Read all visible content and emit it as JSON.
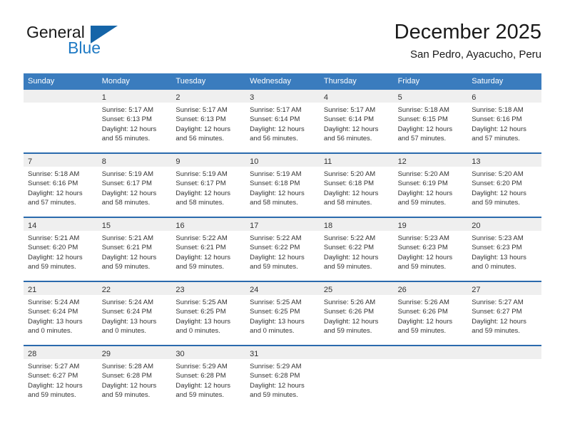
{
  "brand": {
    "name_part1": "General",
    "name_part2": "Blue",
    "accent_color": "#1565a8",
    "text_color": "#1f7ac4"
  },
  "header": {
    "title": "December 2025",
    "subtitle": "San Pedro, Ayacucho, Peru"
  },
  "theme": {
    "header_bg": "#3a7cbe",
    "week_divider": "#2a6aad",
    "day_number_bg": "#efefef"
  },
  "weekdays": [
    "Sunday",
    "Monday",
    "Tuesday",
    "Wednesday",
    "Thursday",
    "Friday",
    "Saturday"
  ],
  "weeks": [
    [
      {
        "empty": true
      },
      {
        "day": "1",
        "sunrise": "Sunrise: 5:17 AM",
        "sunset": "Sunset: 6:13 PM",
        "daylight1": "Daylight: 12 hours",
        "daylight2": "and 55 minutes."
      },
      {
        "day": "2",
        "sunrise": "Sunrise: 5:17 AM",
        "sunset": "Sunset: 6:13 PM",
        "daylight1": "Daylight: 12 hours",
        "daylight2": "and 56 minutes."
      },
      {
        "day": "3",
        "sunrise": "Sunrise: 5:17 AM",
        "sunset": "Sunset: 6:14 PM",
        "daylight1": "Daylight: 12 hours",
        "daylight2": "and 56 minutes."
      },
      {
        "day": "4",
        "sunrise": "Sunrise: 5:17 AM",
        "sunset": "Sunset: 6:14 PM",
        "daylight1": "Daylight: 12 hours",
        "daylight2": "and 56 minutes."
      },
      {
        "day": "5",
        "sunrise": "Sunrise: 5:18 AM",
        "sunset": "Sunset: 6:15 PM",
        "daylight1": "Daylight: 12 hours",
        "daylight2": "and 57 minutes."
      },
      {
        "day": "6",
        "sunrise": "Sunrise: 5:18 AM",
        "sunset": "Sunset: 6:16 PM",
        "daylight1": "Daylight: 12 hours",
        "daylight2": "and 57 minutes."
      }
    ],
    [
      {
        "day": "7",
        "sunrise": "Sunrise: 5:18 AM",
        "sunset": "Sunset: 6:16 PM",
        "daylight1": "Daylight: 12 hours",
        "daylight2": "and 57 minutes."
      },
      {
        "day": "8",
        "sunrise": "Sunrise: 5:19 AM",
        "sunset": "Sunset: 6:17 PM",
        "daylight1": "Daylight: 12 hours",
        "daylight2": "and 58 minutes."
      },
      {
        "day": "9",
        "sunrise": "Sunrise: 5:19 AM",
        "sunset": "Sunset: 6:17 PM",
        "daylight1": "Daylight: 12 hours",
        "daylight2": "and 58 minutes."
      },
      {
        "day": "10",
        "sunrise": "Sunrise: 5:19 AM",
        "sunset": "Sunset: 6:18 PM",
        "daylight1": "Daylight: 12 hours",
        "daylight2": "and 58 minutes."
      },
      {
        "day": "11",
        "sunrise": "Sunrise: 5:20 AM",
        "sunset": "Sunset: 6:18 PM",
        "daylight1": "Daylight: 12 hours",
        "daylight2": "and 58 minutes."
      },
      {
        "day": "12",
        "sunrise": "Sunrise: 5:20 AM",
        "sunset": "Sunset: 6:19 PM",
        "daylight1": "Daylight: 12 hours",
        "daylight2": "and 59 minutes."
      },
      {
        "day": "13",
        "sunrise": "Sunrise: 5:20 AM",
        "sunset": "Sunset: 6:20 PM",
        "daylight1": "Daylight: 12 hours",
        "daylight2": "and 59 minutes."
      }
    ],
    [
      {
        "day": "14",
        "sunrise": "Sunrise: 5:21 AM",
        "sunset": "Sunset: 6:20 PM",
        "daylight1": "Daylight: 12 hours",
        "daylight2": "and 59 minutes."
      },
      {
        "day": "15",
        "sunrise": "Sunrise: 5:21 AM",
        "sunset": "Sunset: 6:21 PM",
        "daylight1": "Daylight: 12 hours",
        "daylight2": "and 59 minutes."
      },
      {
        "day": "16",
        "sunrise": "Sunrise: 5:22 AM",
        "sunset": "Sunset: 6:21 PM",
        "daylight1": "Daylight: 12 hours",
        "daylight2": "and 59 minutes."
      },
      {
        "day": "17",
        "sunrise": "Sunrise: 5:22 AM",
        "sunset": "Sunset: 6:22 PM",
        "daylight1": "Daylight: 12 hours",
        "daylight2": "and 59 minutes."
      },
      {
        "day": "18",
        "sunrise": "Sunrise: 5:22 AM",
        "sunset": "Sunset: 6:22 PM",
        "daylight1": "Daylight: 12 hours",
        "daylight2": "and 59 minutes."
      },
      {
        "day": "19",
        "sunrise": "Sunrise: 5:23 AM",
        "sunset": "Sunset: 6:23 PM",
        "daylight1": "Daylight: 12 hours",
        "daylight2": "and 59 minutes."
      },
      {
        "day": "20",
        "sunrise": "Sunrise: 5:23 AM",
        "sunset": "Sunset: 6:23 PM",
        "daylight1": "Daylight: 13 hours",
        "daylight2": "and 0 minutes."
      }
    ],
    [
      {
        "day": "21",
        "sunrise": "Sunrise: 5:24 AM",
        "sunset": "Sunset: 6:24 PM",
        "daylight1": "Daylight: 13 hours",
        "daylight2": "and 0 minutes."
      },
      {
        "day": "22",
        "sunrise": "Sunrise: 5:24 AM",
        "sunset": "Sunset: 6:24 PM",
        "daylight1": "Daylight: 13 hours",
        "daylight2": "and 0 minutes."
      },
      {
        "day": "23",
        "sunrise": "Sunrise: 5:25 AM",
        "sunset": "Sunset: 6:25 PM",
        "daylight1": "Daylight: 13 hours",
        "daylight2": "and 0 minutes."
      },
      {
        "day": "24",
        "sunrise": "Sunrise: 5:25 AM",
        "sunset": "Sunset: 6:25 PM",
        "daylight1": "Daylight: 13 hours",
        "daylight2": "and 0 minutes."
      },
      {
        "day": "25",
        "sunrise": "Sunrise: 5:26 AM",
        "sunset": "Sunset: 6:26 PM",
        "daylight1": "Daylight: 12 hours",
        "daylight2": "and 59 minutes."
      },
      {
        "day": "26",
        "sunrise": "Sunrise: 5:26 AM",
        "sunset": "Sunset: 6:26 PM",
        "daylight1": "Daylight: 12 hours",
        "daylight2": "and 59 minutes."
      },
      {
        "day": "27",
        "sunrise": "Sunrise: 5:27 AM",
        "sunset": "Sunset: 6:27 PM",
        "daylight1": "Daylight: 12 hours",
        "daylight2": "and 59 minutes."
      }
    ],
    [
      {
        "day": "28",
        "sunrise": "Sunrise: 5:27 AM",
        "sunset": "Sunset: 6:27 PM",
        "daylight1": "Daylight: 12 hours",
        "daylight2": "and 59 minutes."
      },
      {
        "day": "29",
        "sunrise": "Sunrise: 5:28 AM",
        "sunset": "Sunset: 6:28 PM",
        "daylight1": "Daylight: 12 hours",
        "daylight2": "and 59 minutes."
      },
      {
        "day": "30",
        "sunrise": "Sunrise: 5:29 AM",
        "sunset": "Sunset: 6:28 PM",
        "daylight1": "Daylight: 12 hours",
        "daylight2": "and 59 minutes."
      },
      {
        "day": "31",
        "sunrise": "Sunrise: 5:29 AM",
        "sunset": "Sunset: 6:28 PM",
        "daylight1": "Daylight: 12 hours",
        "daylight2": "and 59 minutes."
      },
      {
        "empty": true
      },
      {
        "empty": true
      },
      {
        "empty": true
      }
    ]
  ]
}
